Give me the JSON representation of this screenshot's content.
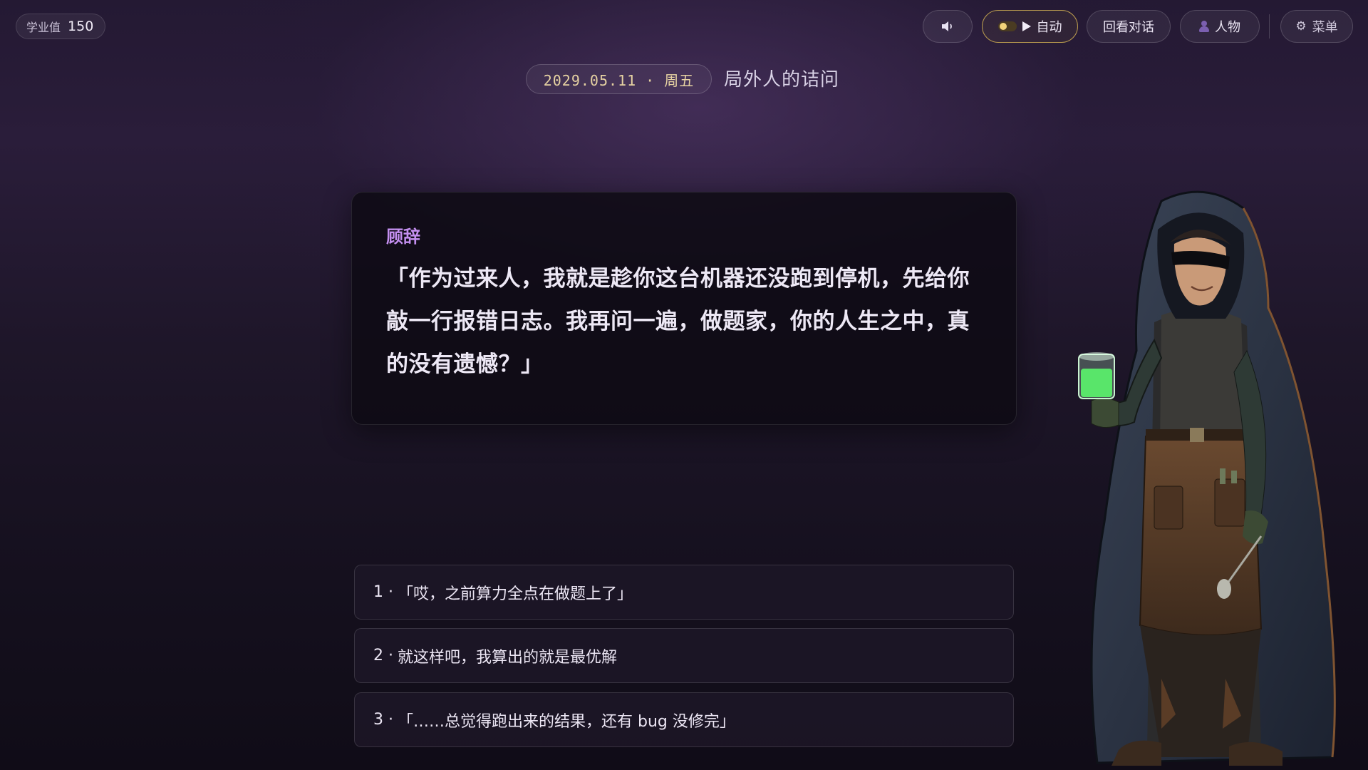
{
  "hud": {
    "score_label": "学业值",
    "score_value": "150"
  },
  "toolbar": {
    "sound_icon": "speaker-icon",
    "auto_label": "自动",
    "log_label": "回看对话",
    "characters_label": "人物",
    "menu_label": "菜单"
  },
  "scene": {
    "date": "2029.05.11 · 周五",
    "chapter_title": "局外人的诘问"
  },
  "dialogue": {
    "speaker": "顾辞",
    "text": "「作为过来人，我就是趁你这台机器还没跑到停机，先给你敲一行报错日志。我再问一遍，做题家，你的人生之中，真的没有遗憾？」"
  },
  "choices": [
    {
      "num": "1 ·",
      "text": "「哎，之前算力全点在做题上了」"
    },
    {
      "num": "2 ·",
      "text": "就这样吧，我算出的就是最优解"
    },
    {
      "num": "3 ·",
      "text": "「……总觉得跑出来的结果，还有 bug 没修完」"
    }
  ],
  "colors": {
    "speaker": "#c48ff0",
    "date_text": "#e6d2a2",
    "auto_border": "#b89a4e",
    "potion_green": "#5dff6e"
  }
}
